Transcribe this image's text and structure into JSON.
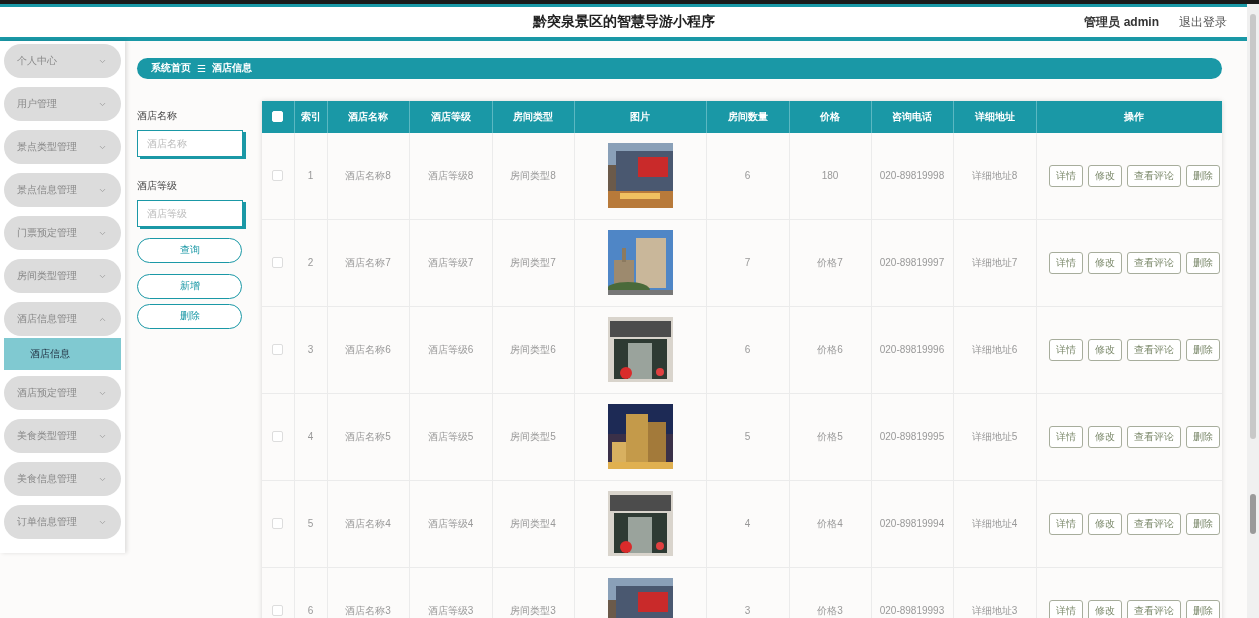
{
  "header": {
    "title": "黔突泉景区的智慧导游小程序",
    "user": "管理员 admin",
    "logout": "退出登录"
  },
  "sidebar": {
    "items": [
      {
        "label": "个人中心",
        "expanded": false
      },
      {
        "label": "用户管理",
        "expanded": false
      },
      {
        "label": "景点类型管理",
        "expanded": false
      },
      {
        "label": "景点信息管理",
        "expanded": false
      },
      {
        "label": "门票预定管理",
        "expanded": false
      },
      {
        "label": "房间类型管理",
        "expanded": false
      },
      {
        "label": "酒店信息管理",
        "expanded": true,
        "children": [
          {
            "label": "酒店信息",
            "selected": true
          }
        ]
      },
      {
        "label": "酒店预定管理",
        "expanded": false
      },
      {
        "label": "美食类型管理",
        "expanded": false
      },
      {
        "label": "美食信息管理",
        "expanded": false
      },
      {
        "label": "订单信息管理",
        "expanded": false
      }
    ]
  },
  "breadcrumb": {
    "home": "系统首页",
    "separator": "☰",
    "current": "酒店信息"
  },
  "search": {
    "fields": [
      {
        "label": "酒店名称",
        "placeholder": "酒店名称"
      },
      {
        "label": "酒店等级",
        "placeholder": "酒店等级"
      }
    ],
    "buttons": [
      "查询",
      "新增",
      "删除"
    ]
  },
  "table": {
    "select_all": {
      "checked": false
    },
    "columns": [
      "索引",
      "酒店名称",
      "酒店等级",
      "房间类型",
      "图片",
      "房间数量",
      "价格",
      "咨询电话",
      "详细地址",
      "操作"
    ],
    "rows": [
      {
        "checked": false,
        "cells": [
          "1",
          "酒店名称8",
          "酒店等级8",
          "房间类型8"
        ],
        "cells_after": [
          "6",
          "180",
          "020-89819998",
          "详细地址8"
        ],
        "actions": [
          "详情",
          "修改",
          "查看评论",
          "删除"
        ]
      },
      {
        "checked": false,
        "cells": [
          "2",
          "酒店名称7",
          "酒店等级7",
          "房间类型7"
        ],
        "cells_after": [
          "7",
          "价格7",
          "020-89819997",
          "详细地址7"
        ],
        "actions": [
          "详情",
          "修改",
          "查看评论",
          "删除"
        ]
      },
      {
        "checked": false,
        "cells": [
          "3",
          "酒店名称6",
          "酒店等级6",
          "房间类型6"
        ],
        "cells_after": [
          "6",
          "价格6",
          "020-89819996",
          "详细地址6"
        ],
        "actions": [
          "详情",
          "修改",
          "查看评论",
          "删除"
        ]
      },
      {
        "checked": false,
        "cells": [
          "4",
          "酒店名称5",
          "酒店等级5",
          "房间类型5"
        ],
        "cells_after": [
          "5",
          "价格5",
          "020-89819995",
          "详细地址5"
        ],
        "actions": [
          "详情",
          "修改",
          "查看评论",
          "删除"
        ]
      },
      {
        "checked": false,
        "cells": [
          "5",
          "酒店名称4",
          "酒店等级4",
          "房间类型4"
        ],
        "cells_after": [
          "4",
          "价格4",
          "020-89819994",
          "详细地址4"
        ],
        "actions": [
          "详情",
          "修改",
          "查看评论",
          "删除"
        ]
      },
      {
        "checked": false,
        "cells": [
          "6",
          "酒店名称3",
          "酒店等级3",
          "房间类型3"
        ],
        "cells_after": [
          "3",
          "价格3",
          "020-89819993",
          "详细地址3"
        ],
        "actions": [
          "详情",
          "修改",
          "查看评论",
          "删除"
        ]
      }
    ]
  }
}
